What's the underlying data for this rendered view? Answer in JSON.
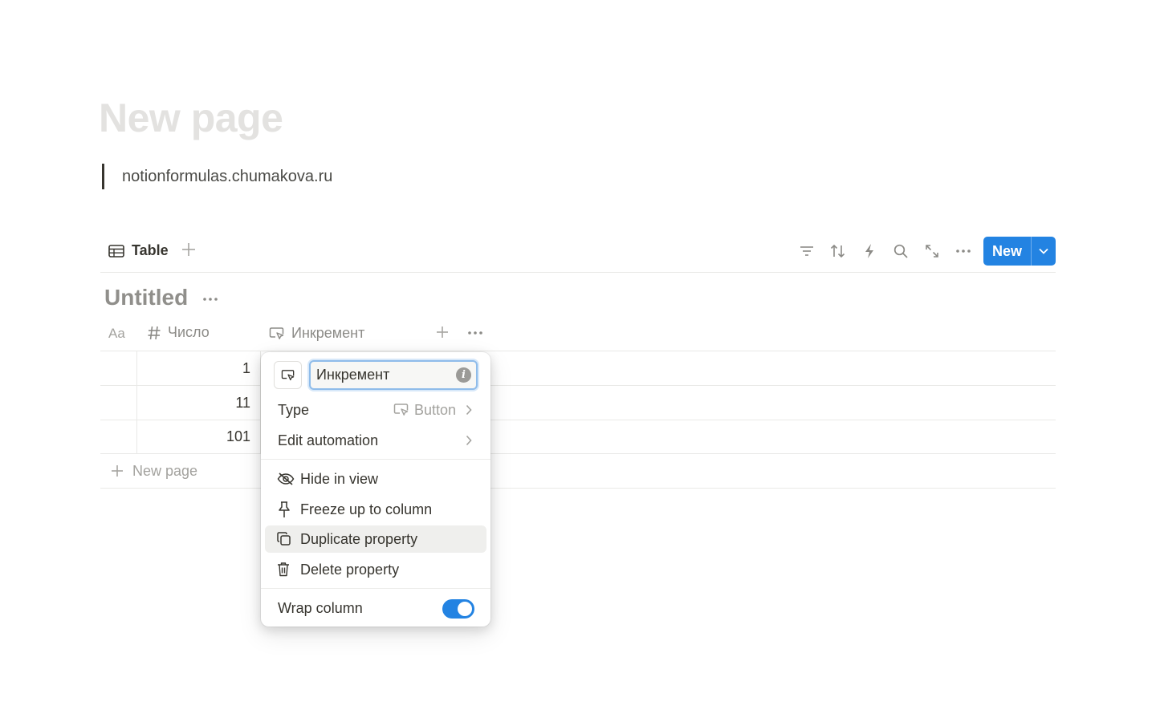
{
  "page": {
    "title": "New page",
    "quote": "notionformulas.chumakova.ru"
  },
  "view_bar": {
    "tab_label": "Table",
    "new_label": "New",
    "icons": [
      "filter-icon",
      "sort-icon",
      "automation-icon",
      "search-icon",
      "expand-icon",
      "more-icon"
    ]
  },
  "database": {
    "title": "Untitled",
    "columns": [
      {
        "icon": "title-icon",
        "label": "Aa"
      },
      {
        "icon": "hash-icon",
        "label": "Число"
      },
      {
        "icon": "button-property-icon",
        "label": "Инкремент"
      }
    ],
    "rows": [
      {
        "number": "1"
      },
      {
        "number": "11"
      },
      {
        "number": "101"
      }
    ],
    "new_row_label": "New page"
  },
  "property_menu": {
    "name_value": "Инкремент",
    "type_label": "Type",
    "type_value": "Button",
    "edit_automation": "Edit automation",
    "hide_in_view": "Hide in view",
    "freeze": "Freeze up to column",
    "duplicate": "Duplicate property",
    "delete": "Delete property",
    "wrap_column": "Wrap column",
    "wrap_enabled": true
  },
  "colors": {
    "accent": "#2383e2",
    "text": "#37352f",
    "muted": "#a3a29e",
    "title_placeholder": "#e3e2e0"
  }
}
